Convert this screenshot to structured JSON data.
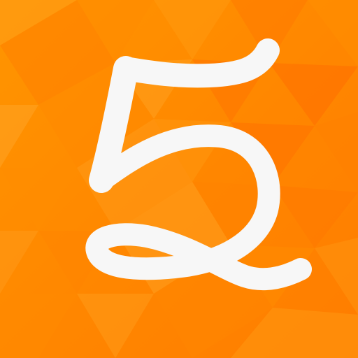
{
  "app_icon": {
    "name": "five-app-icon",
    "glyph": "5",
    "glyph_color": "#f7f7f7",
    "background": {
      "base_color": "#ff8a00",
      "light_color": "#ffa21a",
      "dark_color": "#ff6f00",
      "pattern": "triangles"
    }
  }
}
